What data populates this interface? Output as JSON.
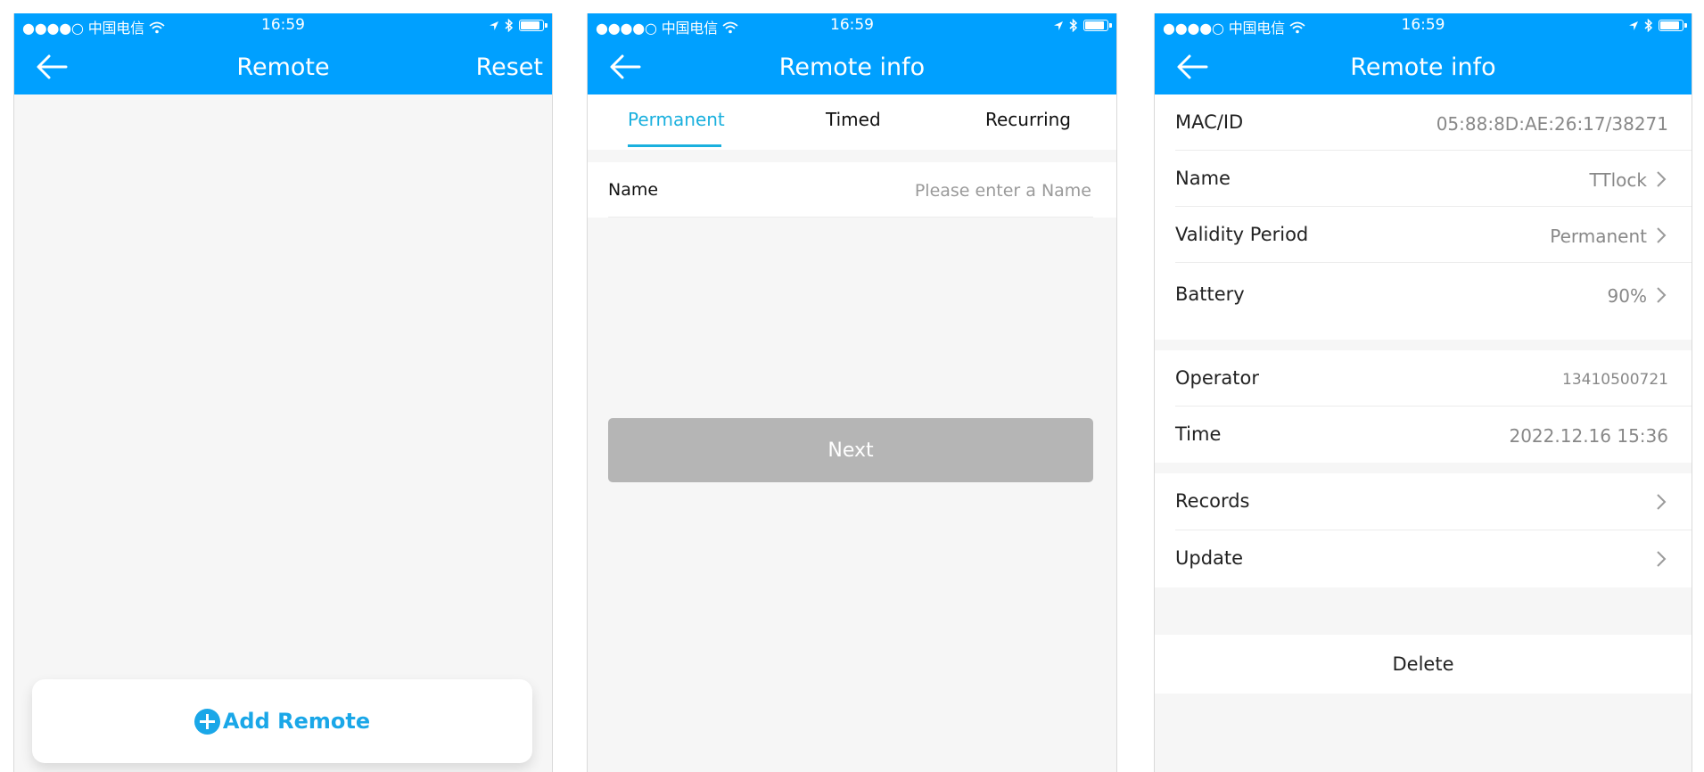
{
  "statusbar": {
    "carrier": "●●●●○ 中国电信",
    "time": "16:59"
  },
  "screen_remote": {
    "title": "Remote",
    "reset_label": "Reset",
    "add_label": "Add Remote"
  },
  "screen_add": {
    "title": "Remote info",
    "tabs": [
      {
        "label": "Permanent",
        "active": true
      },
      {
        "label": "Timed",
        "active": false
      },
      {
        "label": "Recurring",
        "active": false
      }
    ],
    "name_label": "Name",
    "name_placeholder": "Please enter a Name",
    "next_label": "Next"
  },
  "screen_info": {
    "title": "Remote info",
    "rows": [
      {
        "label": "MAC/ID",
        "value": "05:88:8D:AE:26:17/38271"
      },
      {
        "label": "Name",
        "value": "TTlock"
      },
      {
        "label": "Validity Period",
        "value": "Permanent"
      },
      {
        "label": "Battery",
        "value": "90%"
      },
      {
        "label": "Operator",
        "value": "13410500721"
      },
      {
        "label": "Time",
        "value": "2022.12.16 15:36"
      },
      {
        "label": "Records",
        "value": ""
      },
      {
        "label": "Update",
        "value": ""
      }
    ],
    "delete_label": "Delete"
  },
  "colors": {
    "header": "#00a0ff",
    "accent": "#1ab0de",
    "add_button": "#1aa7e8",
    "disabled_button": "#b5b5b5",
    "background": "#f6f6f6"
  },
  "icons": [
    "back-arrow-icon",
    "signal-dots-icon",
    "wifi-icon",
    "location-arrow-icon",
    "bluetooth-icon",
    "battery-icon",
    "plus-circle-icon",
    "chevron-right-icon"
  ]
}
